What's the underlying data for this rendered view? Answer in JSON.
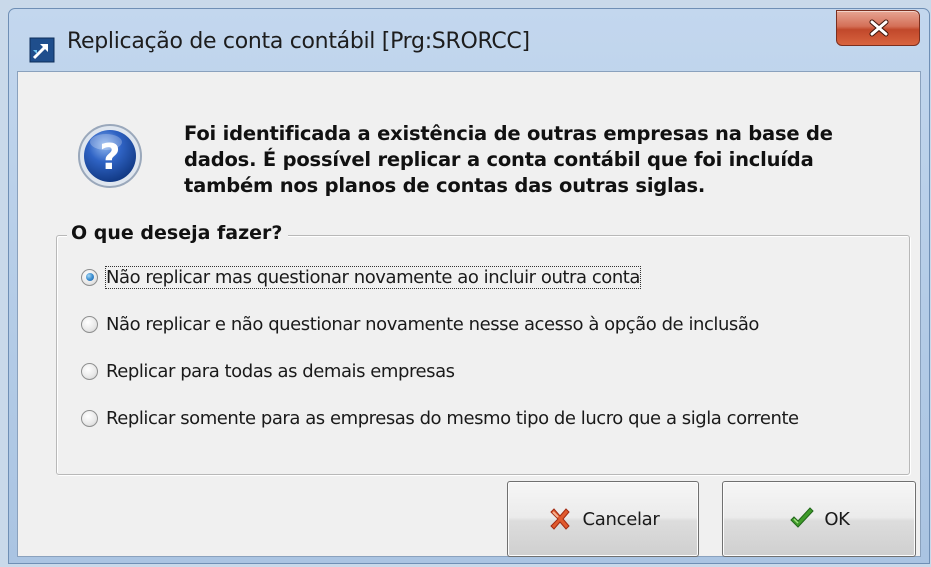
{
  "window": {
    "title": "Replicação de conta contábil [Prg:SRORCC]",
    "app_icon": "app-arrow-icon",
    "close_icon": "close-icon"
  },
  "message": {
    "icon": "question-icon",
    "lines": [
      "Foi identificada a existência de outras empresas na base de",
      "dados. É possível replicar a conta contábil que foi incluída",
      "também nos planos de contas das outras siglas."
    ]
  },
  "group": {
    "title": "O que deseja fazer?",
    "options": [
      {
        "label": "Não replicar mas questionar novamente ao incluir outra conta",
        "checked": true
      },
      {
        "label": "Não replicar e não questionar novamente nesse acesso à opção de inclusão",
        "checked": false
      },
      {
        "label": "Replicar para todas as demais empresas",
        "checked": false
      },
      {
        "label": "Replicar somente para as empresas do mesmo tipo de lucro que a sigla corrente",
        "checked": false
      }
    ]
  },
  "buttons": {
    "cancel": {
      "label": "Cancelar",
      "icon": "red-x-cancel-icon"
    },
    "ok": {
      "label": "OK",
      "icon": "green-checkmark-icon"
    }
  },
  "colors": {
    "frame": "#b3cbe6",
    "client_bg": "#f0f0f0",
    "close_button": "#c1482b",
    "radio_selected": "#3d8fd0"
  }
}
